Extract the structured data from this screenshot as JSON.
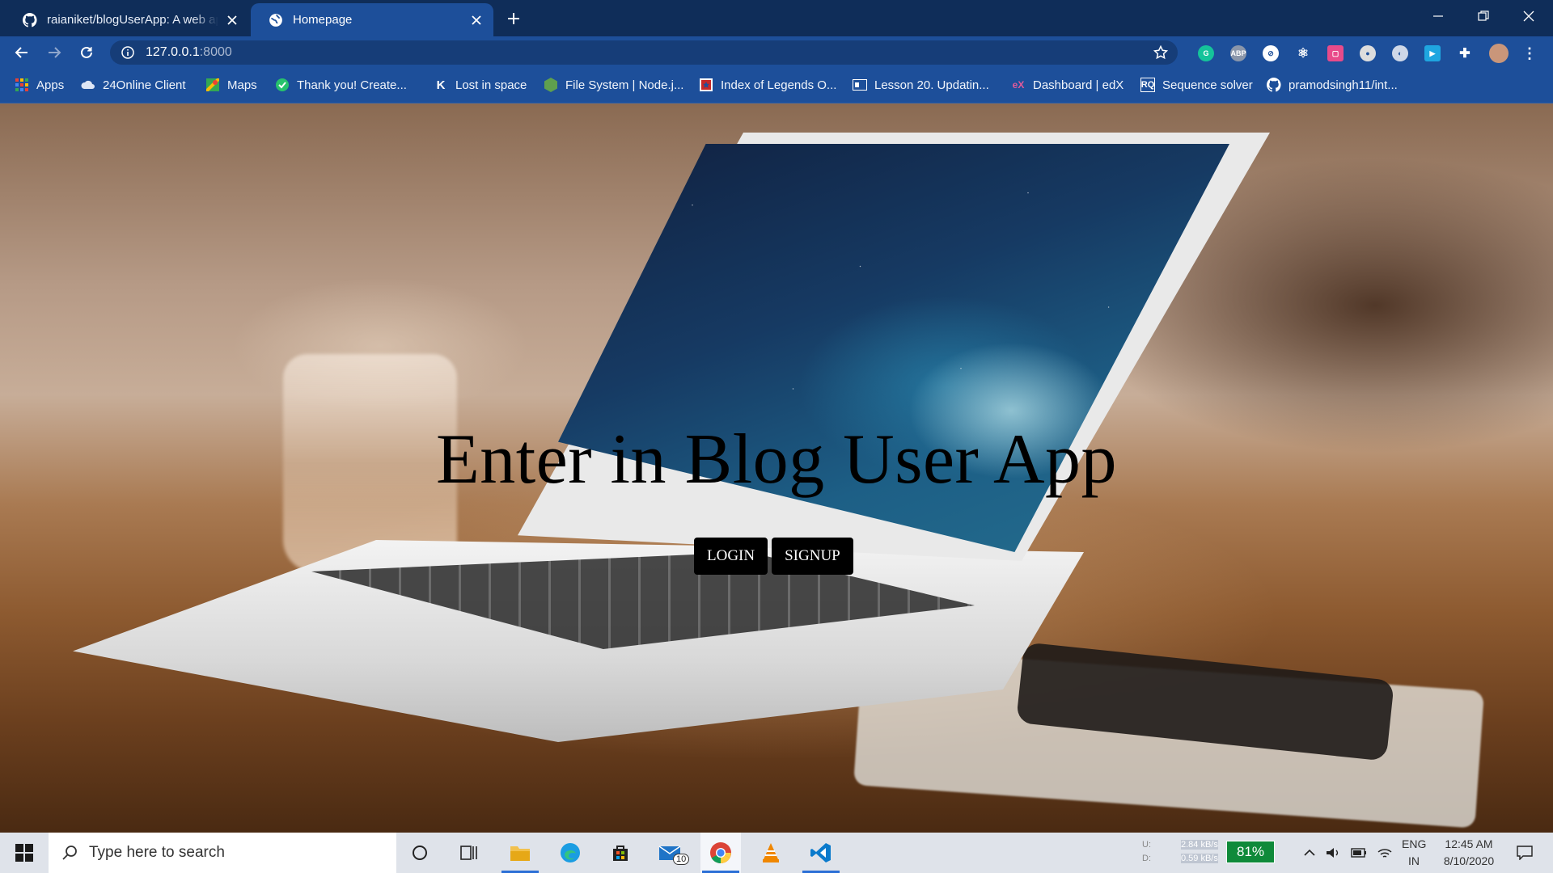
{
  "browser": {
    "tabs": [
      {
        "title": "raianiket/blogUserApp: A web ap",
        "active": false,
        "favicon": "github-icon"
      },
      {
        "title": "Homepage",
        "active": true,
        "favicon": "globe-icon"
      }
    ],
    "url_host": "127.0.0.1",
    "url_port": ":8000",
    "bookmarks": [
      {
        "label": "Apps",
        "icon": "apps-grid-icon"
      },
      {
        "label": "24Online Client",
        "icon": "cloud-icon"
      },
      {
        "label": "Maps",
        "icon": "maps-icon"
      },
      {
        "label": "Thank you! Create...",
        "icon": "thankyou-icon"
      },
      {
        "label": "Lost in space",
        "icon": "k-icon"
      },
      {
        "label": "File System | Node.j...",
        "icon": "nodejs-icon"
      },
      {
        "label": "Index of Legends O...",
        "icon": "legends-icon"
      },
      {
        "label": "Lesson 20. Updatin...",
        "icon": "lesson-icon"
      },
      {
        "label": "Dashboard | edX",
        "icon": "edx-icon"
      },
      {
        "label": "Sequence solver",
        "icon": "sequence-icon"
      },
      {
        "label": "pramodsingh11/int...",
        "icon": "github-icon"
      }
    ],
    "accent": "#1d4f9a"
  },
  "page": {
    "heading": "Enter in Blog User App",
    "login_label": "LOGIN",
    "signup_label": "SIGNUP"
  },
  "taskbar": {
    "search_placeholder": "Type here to search",
    "mail_badge": "10",
    "net_up_label": "U:",
    "net_down_label": "D:",
    "net_up": "2.84 kB/s",
    "net_down": "0.59 kB/s",
    "battery": "81%",
    "lang": "ENG",
    "region": "IN",
    "time": "12:45 AM",
    "date": "8/10/2020"
  }
}
